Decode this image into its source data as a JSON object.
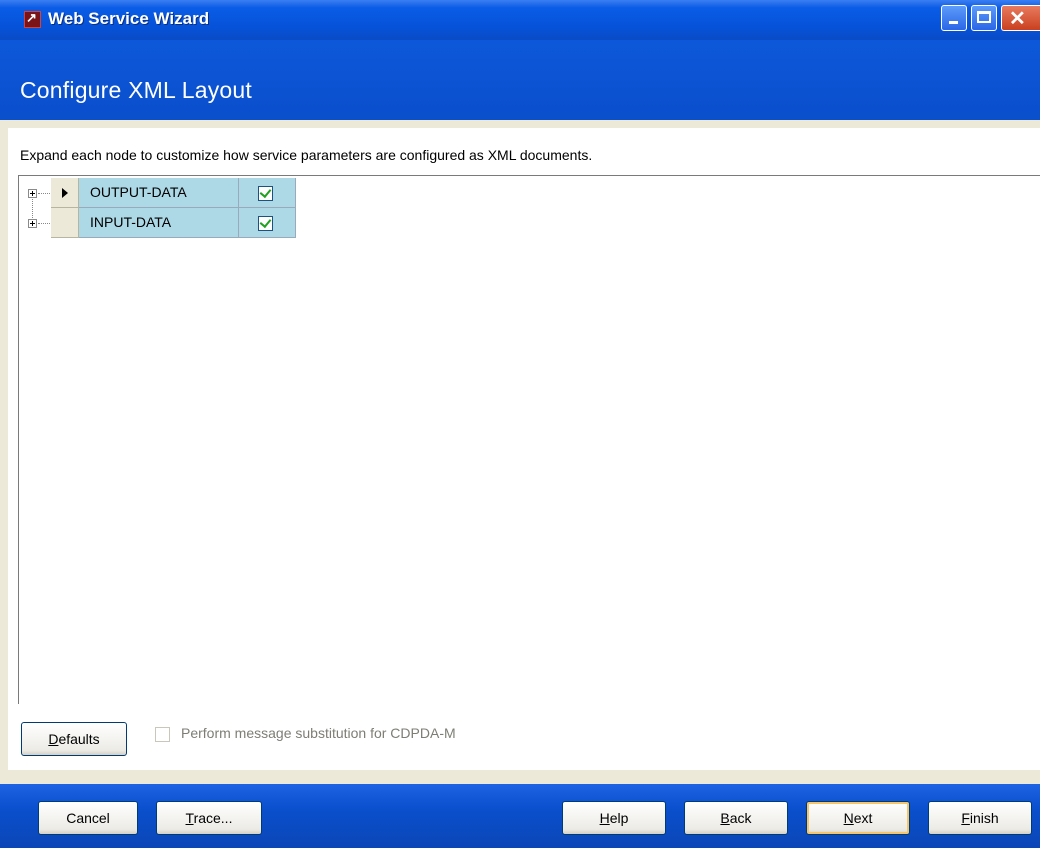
{
  "window": {
    "title": "Web Service Wizard"
  },
  "header": {
    "title": "Configure XML Layout"
  },
  "main": {
    "instruction": "Expand each node to customize how service parameters are configured as XML documents.",
    "tree_rows": [
      {
        "label": "OUTPUT-DATA",
        "checked": true,
        "current": true
      },
      {
        "label": "INPUT-DATA",
        "checked": true,
        "current": false
      }
    ],
    "defaults_label": "Defaults",
    "substitution_label": "Perform message substitution for CDPDA-M",
    "substitution_checked": false
  },
  "footer": {
    "cancel_label": "Cancel",
    "trace_label": "Trace...",
    "help_label": "Help",
    "back_label": "Back",
    "next_label": "Next",
    "finish_label": "Finish"
  },
  "colors": {
    "title_bar": "#0652d8",
    "header_band": "#0a4fcc",
    "cell_highlight": "#add8e6",
    "checkmark": "#21a121"
  }
}
